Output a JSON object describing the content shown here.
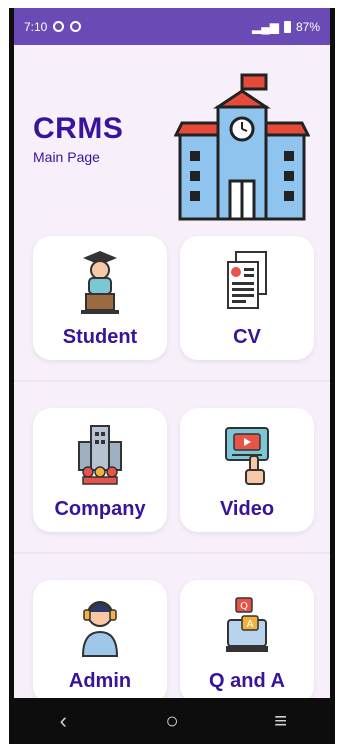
{
  "status_bar": {
    "time": "7:10",
    "indicators": "⚙ ⚙",
    "battery": "87%"
  },
  "header": {
    "title": "CRMS",
    "subtitle": "Main Page"
  },
  "cards": [
    {
      "label": "Student",
      "icon": "student-icon"
    },
    {
      "label": "CV",
      "icon": "cv-icon"
    },
    {
      "label": "Company",
      "icon": "company-icon"
    },
    {
      "label": "Video",
      "icon": "video-icon"
    },
    {
      "label": "Admin",
      "icon": "admin-icon"
    },
    {
      "label": "Q and A",
      "icon": "qa-icon"
    }
  ],
  "colors": {
    "accent": "#3a139b",
    "status_bar": "#6a4bb6",
    "background": "#f7f0fb"
  },
  "nav": {
    "back": "‹",
    "home": "○",
    "recents": "≡"
  }
}
